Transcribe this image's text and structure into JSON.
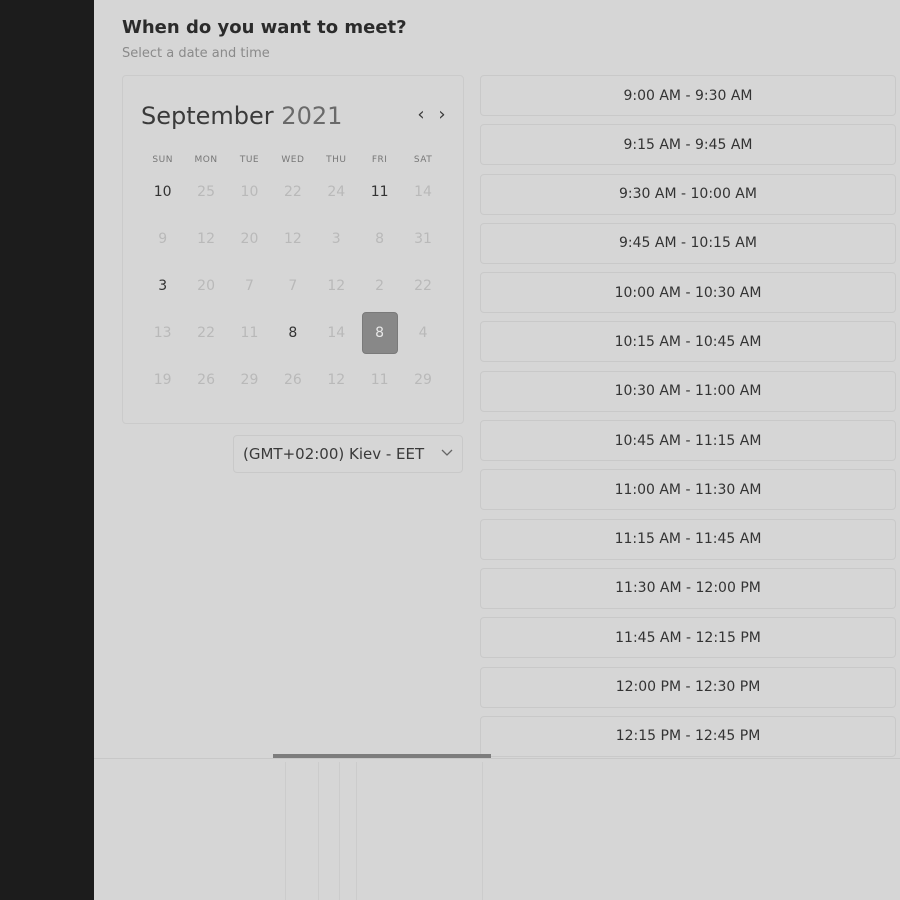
{
  "header": {
    "title": "When do you want to meet?",
    "subtitle": "Select a date and time"
  },
  "calendar": {
    "month": "September",
    "year": "2021",
    "prev_icon": "chevron-left-icon",
    "next_icon": "chevron-right-icon",
    "weekdays": [
      "SUN",
      "MON",
      "TUE",
      "WED",
      "THU",
      "FRI",
      "SAT"
    ],
    "weeks": [
      [
        "10",
        "25",
        "10",
        "22",
        "24",
        "11",
        "14"
      ],
      [
        "9",
        "12",
        "20",
        "12",
        "3",
        "8",
        "31"
      ],
      [
        "3",
        "20",
        "7",
        "7",
        "12",
        "2",
        "22"
      ],
      [
        "13",
        "22",
        "11",
        "8",
        "14",
        "8",
        "4"
      ],
      [
        "19",
        "26",
        "29",
        "26",
        "12",
        "11",
        "29"
      ]
    ],
    "available": [
      [
        0,
        0
      ],
      [
        0,
        5
      ],
      [
        2,
        0
      ],
      [
        3,
        3
      ]
    ],
    "selected": [
      3,
      5
    ]
  },
  "timezone": {
    "label": "(GMT+02:00) Kiev - EET",
    "icon": "chevron-down-icon"
  },
  "slots": [
    "9:00 AM - 9:30 AM",
    "9:15 AM - 9:45 AM",
    "9:30 AM - 10:00 AM",
    "9:45 AM - 10:15 AM",
    "10:00 AM - 10:30 AM",
    "10:15 AM - 10:45 AM",
    "10:30 AM - 11:00 AM",
    "10:45 AM - 11:15 AM",
    "11:00 AM - 11:30 AM",
    "11:15 AM - 11:45 AM",
    "11:30 AM - 12:00 PM",
    "11:45 AM - 12:15 PM",
    "12:00 PM - 12:30 PM",
    "12:15 PM - 12:45 PM"
  ]
}
